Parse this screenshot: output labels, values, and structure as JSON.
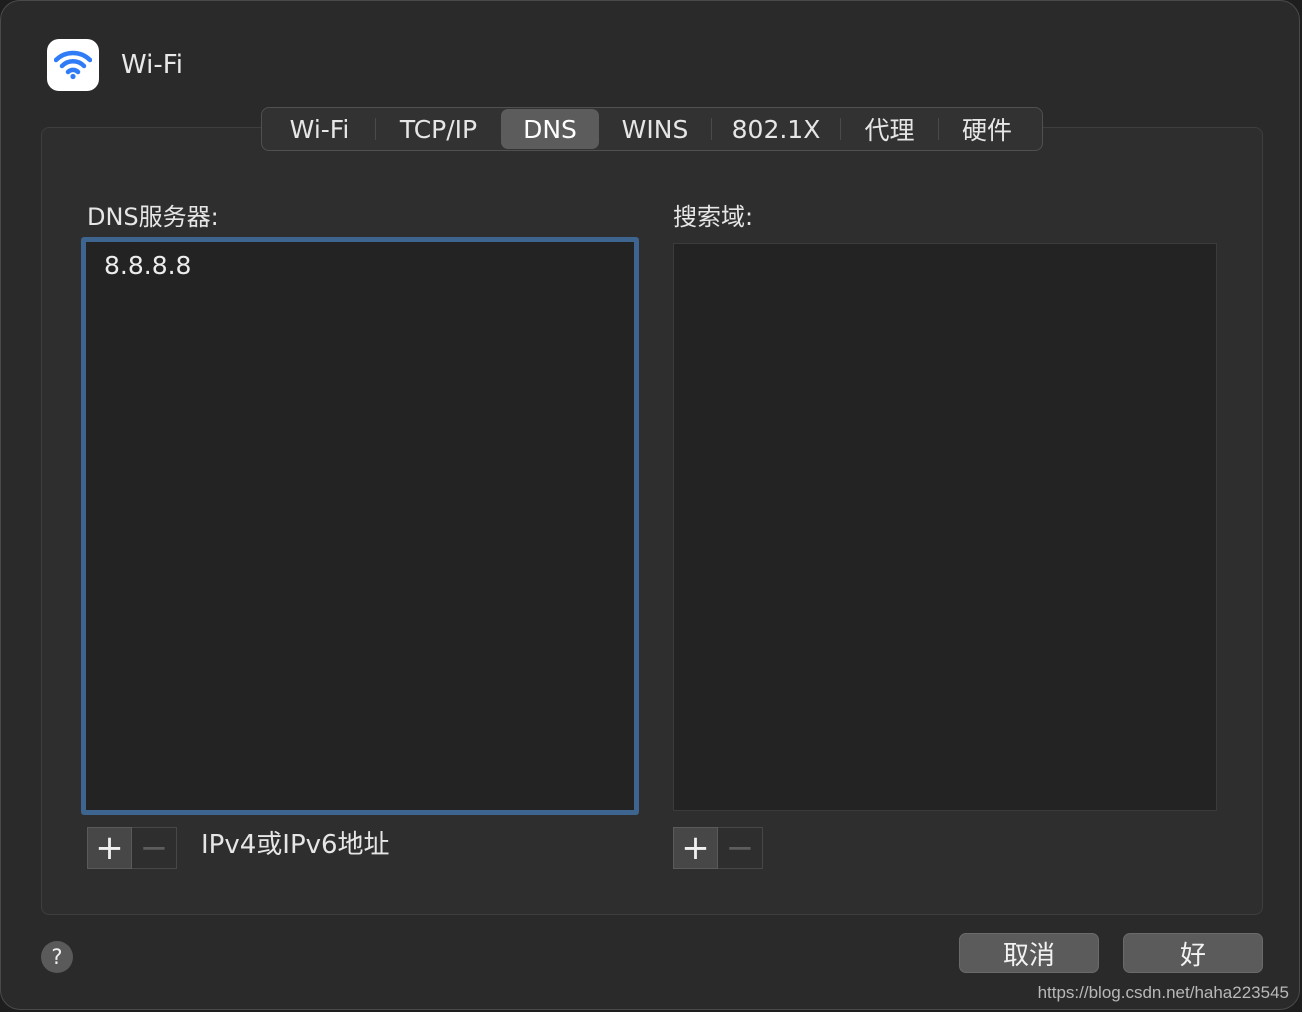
{
  "window": {
    "title": "Wi-Fi"
  },
  "tabs": [
    {
      "label": "Wi-Fi",
      "active": false
    },
    {
      "label": "TCP/IP",
      "active": false
    },
    {
      "label": "DNS",
      "active": true
    },
    {
      "label": "WINS",
      "active": false
    },
    {
      "label": "802.1X",
      "active": false
    },
    {
      "label": "代理",
      "active": false
    },
    {
      "label": "硬件",
      "active": false
    }
  ],
  "dns_servers": {
    "label": "DNS服务器:",
    "entries": [
      "8.8.8.8"
    ],
    "add_label": "+",
    "remove_label": "−",
    "hint": "IPv4或IPv6地址"
  },
  "search_domains": {
    "label": "搜索域:",
    "entries": [],
    "add_label": "+",
    "remove_label": "−"
  },
  "footer": {
    "help_label": "?",
    "cancel_label": "取消",
    "ok_label": "好"
  },
  "watermark": "https://blog.csdn.net/haha223545",
  "colors": {
    "focus_ring": "#3d6590",
    "wifi_icon": "#2f7cf6"
  }
}
